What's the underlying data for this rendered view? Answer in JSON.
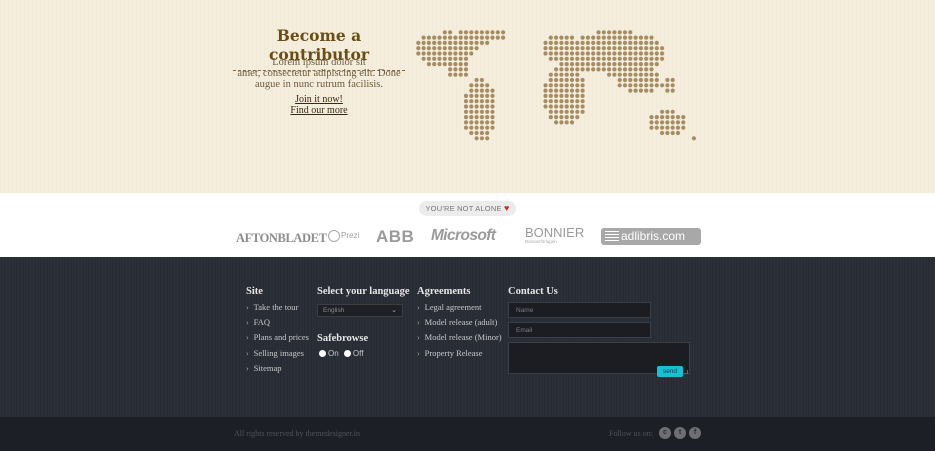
{
  "hero": {
    "title": "Become a contributor",
    "text_line1": "Lorem ipsum dolor sit",
    "text_line2": "amet, consectetur adipiscing elit. Done",
    "text_line3": "augue in nunc rutrum facilisis.",
    "link_join": "Join it now!",
    "link_find": "Find our more",
    "map_color": "#a58c62"
  },
  "partners": {
    "badge_text": "YOU'RE NOT ALONE",
    "badge_heart": "♥",
    "logos": {
      "aftonbladet": "AFTONBLADET",
      "prezi": "Prezi",
      "abb": "ABB",
      "microsoft": "Microsoft",
      "bonnier": "BONNIER",
      "bonnier_sub": "Bonnierförlagen",
      "adlibris": "adlibris.com"
    }
  },
  "footer": {
    "site": {
      "title": "Site",
      "items": [
        "Take the tour",
        "FAQ",
        "Plans and prices",
        "Selling images",
        "Sitemap"
      ]
    },
    "language": {
      "title": "Select your language",
      "selected": "English",
      "caret": "⌄"
    },
    "safebrowse": {
      "title": "Safebrowse",
      "on_label": "On",
      "off_label": "Off"
    },
    "agreements": {
      "title": "Agreements",
      "items": [
        "Legal agreement",
        "Model release (adult)",
        "Model release (Minor)",
        "Property Release"
      ]
    },
    "contact": {
      "title": "Contact Us",
      "name_placeholder": "Name",
      "email_placeholder": "Email",
      "send_label": "send"
    }
  },
  "bottom": {
    "copyright": "All rights reserved by themedesigner.in",
    "follow": "Follow us on:",
    "social": [
      "c",
      "t",
      "f"
    ]
  },
  "colors": {
    "hero_bg": "#f6eedd",
    "footer_bg": "#282c35",
    "send_button": "#19c0d3",
    "heart": "#d42a2a"
  }
}
